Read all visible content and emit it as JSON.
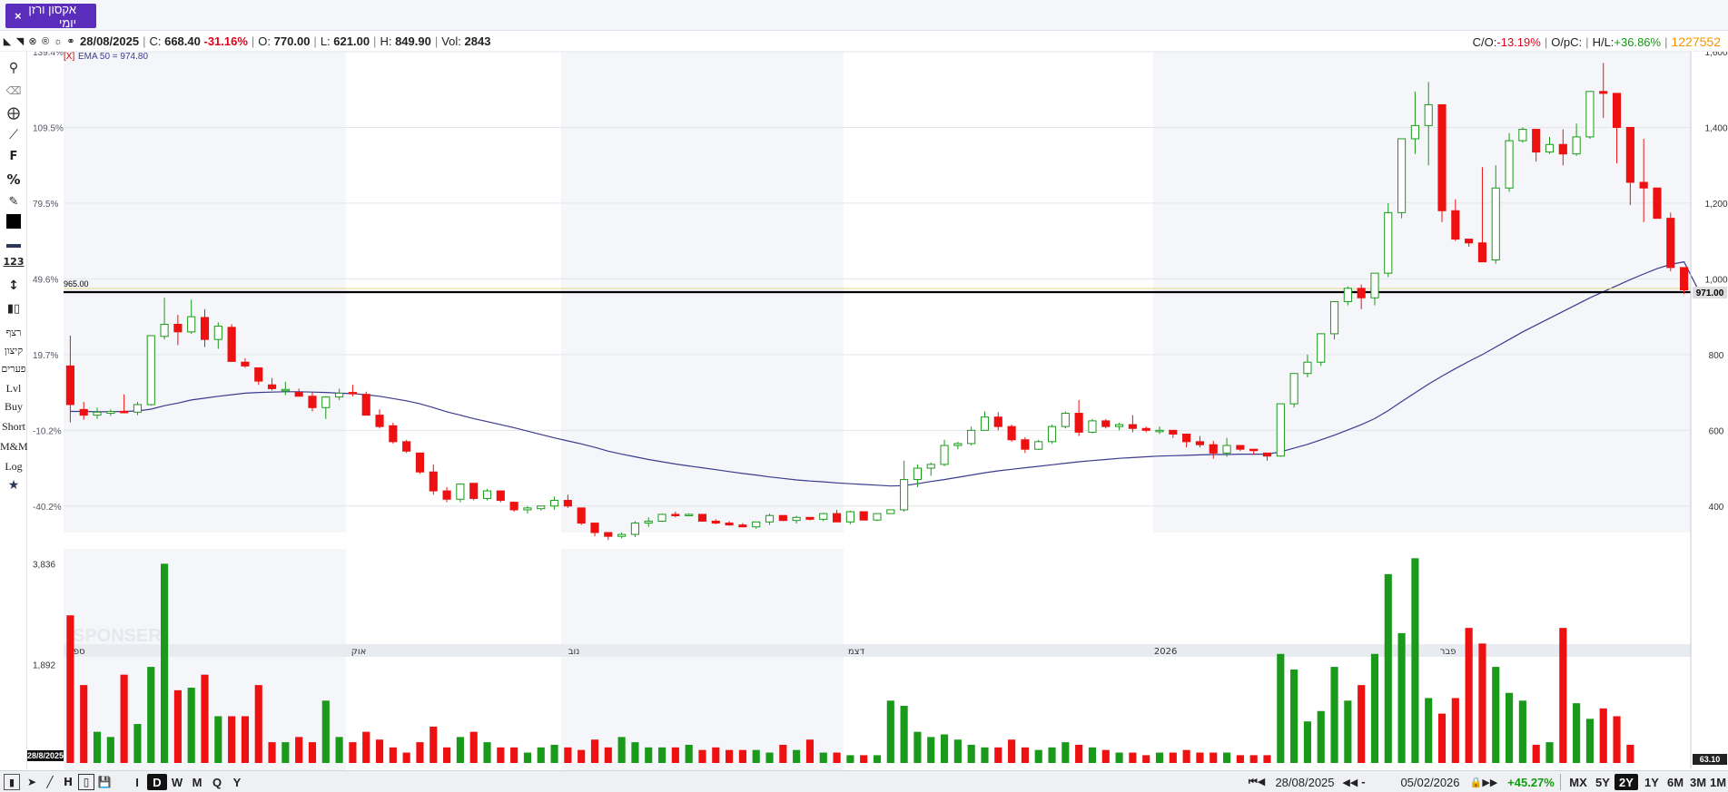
{
  "tab": {
    "label": "אקסון ורזן יומי",
    "close": "×"
  },
  "info": {
    "date": "28/08/2025",
    "c_label": "C:",
    "close": "668.40",
    "change": "-31.16%",
    "o_label": "O:",
    "open": "770.00",
    "l_label": "L:",
    "low": "621.00",
    "h_label": "H:",
    "high": "849.90",
    "vol_label": "Vol:",
    "vol": "2843",
    "co_label": "C/O:",
    "co": "-13.19%",
    "opc_label": "O/pC:",
    "hl_label": "H/L:",
    "hl": "+36.86%",
    "counter": "1227552"
  },
  "ema_label": "[X]",
  "ema_text": "EMA 50 = 974.80",
  "line_label": "965.00",
  "price_badge": "971.00",
  "vol_badge": "63.10",
  "date_badge": "28/8/2025",
  "watermark": "SPONSER",
  "left_labels": [
    "רצף",
    "קיצון",
    "פערים",
    "Lvl",
    "Buy",
    "Short",
    "M&M",
    "Log"
  ],
  "left_icons": [
    "chart-type-icon",
    "trend-icon",
    "crosshair-icon",
    "line-icon",
    "f-icon",
    "percent-icon",
    "pencil-icon",
    "color-icon",
    "line-width-icon",
    "number-icon",
    "vertical-icon",
    "candle-icon"
  ],
  "bottom": {
    "periods": [
      "I",
      "D",
      "W",
      "M",
      "Q",
      "Y"
    ],
    "selected_period": "D",
    "start_date": "28/08/2025",
    "end_date": "05/02/2026",
    "change": "+45.27%",
    "ranges": [
      "MX",
      "5Y",
      "2Y",
      "1Y",
      "6M",
      "3M",
      "1M"
    ],
    "selected_range": "2Y"
  },
  "colors": {
    "up": "#1a9a1a",
    "down": "#ee1111",
    "ema": "#3b3b8f",
    "accent": "#5b2dbd"
  },
  "chart_data": {
    "type": "candlestick",
    "ylim": [
      330,
      1600
    ],
    "yticks": [
      400,
      600,
      800,
      1000,
      1200,
      1400,
      1600
    ],
    "ytick_labels": [
      "400",
      "600",
      "800",
      "1,000",
      "1,200",
      "1,400",
      "1,600"
    ],
    "pct_ticks": [
      139.4,
      109.5,
      79.5,
      49.6,
      19.7,
      -10.2,
      -40.2
    ],
    "pct_labels": [
      "139.4%",
      "109.5%",
      "79.5%",
      "49.6%",
      "19.7%",
      "-10.2%",
      "-40.2%"
    ],
    "months": [
      "ספט",
      "אוק",
      "נוב",
      "דצמ",
      "2026",
      "פבר"
    ],
    "month_index": [
      0,
      21,
      37,
      58,
      81,
      102
    ],
    "hline": 965,
    "ohlc": [
      [
        770,
        850,
        621,
        668
      ],
      [
        655,
        675,
        628,
        640
      ],
      [
        640,
        660,
        630,
        648
      ],
      [
        645,
        655,
        638,
        650
      ],
      [
        650,
        695,
        645,
        648
      ],
      [
        648,
        675,
        640,
        668
      ],
      [
        668,
        850,
        665,
        850
      ],
      [
        848,
        950,
        840,
        880
      ],
      [
        880,
        905,
        825,
        860
      ],
      [
        860,
        945,
        855,
        900
      ],
      [
        898,
        920,
        820,
        840
      ],
      [
        840,
        885,
        815,
        875
      ],
      [
        872,
        880,
        800,
        782
      ],
      [
        780,
        790,
        765,
        770
      ],
      [
        765,
        750,
        720,
        730
      ],
      [
        720,
        738,
        705,
        710
      ],
      [
        705,
        728,
        693,
        708
      ],
      [
        700,
        710,
        695,
        690
      ],
      [
        690,
        700,
        650,
        660
      ],
      [
        660,
        690,
        630,
        688
      ],
      [
        688,
        710,
        680,
        698
      ],
      [
        700,
        720,
        690,
        697
      ],
      [
        695,
        702,
        640,
        640
      ],
      [
        640,
        655,
        605,
        610
      ],
      [
        612,
        620,
        565,
        570
      ],
      [
        570,
        575,
        540,
        545
      ],
      [
        540,
        490,
        485,
        490
      ],
      [
        490,
        510,
        430,
        440
      ],
      [
        440,
        450,
        410,
        418
      ],
      [
        418,
        460,
        410,
        458
      ],
      [
        460,
        460,
        415,
        420
      ],
      [
        420,
        445,
        415,
        440
      ],
      [
        440,
        440,
        410,
        415
      ],
      [
        410,
        412,
        385,
        390
      ],
      [
        390,
        400,
        380,
        395
      ],
      [
        393,
        400,
        388,
        400
      ],
      [
        400,
        425,
        390,
        415
      ],
      [
        415,
        430,
        395,
        400
      ],
      [
        395,
        360,
        350,
        355
      ],
      [
        355,
        355,
        320,
        330
      ],
      [
        330,
        330,
        310,
        320
      ],
      [
        320,
        330,
        315,
        325
      ],
      [
        325,
        360,
        318,
        355
      ],
      [
        355,
        370,
        345,
        360
      ],
      [
        360,
        380,
        358,
        378
      ],
      [
        378,
        385,
        370,
        376
      ],
      [
        376,
        380,
        374,
        378
      ],
      [
        378,
        375,
        360,
        360
      ],
      [
        360,
        365,
        352,
        355
      ],
      [
        355,
        360,
        348,
        350
      ],
      [
        350,
        355,
        345,
        345
      ],
      [
        345,
        358,
        340,
        358
      ],
      [
        358,
        380,
        350,
        375
      ],
      [
        375,
        375,
        360,
        362
      ],
      [
        362,
        374,
        354,
        370
      ],
      [
        370,
        365,
        362,
        365
      ],
      [
        365,
        382,
        360,
        380
      ],
      [
        380,
        390,
        360,
        358
      ],
      [
        358,
        388,
        352,
        385
      ],
      [
        385,
        385,
        362,
        363
      ],
      [
        363,
        380,
        360,
        380
      ],
      [
        380,
        380,
        385,
        390
      ],
      [
        390,
        520,
        385,
        470
      ],
      [
        470,
        510,
        450,
        500
      ],
      [
        500,
        515,
        480,
        510
      ],
      [
        510,
        575,
        505,
        560
      ],
      [
        560,
        570,
        550,
        565
      ],
      [
        565,
        610,
        560,
        600
      ],
      [
        600,
        650,
        600,
        635
      ],
      [
        635,
        648,
        600,
        610
      ],
      [
        610,
        615,
        570,
        575
      ],
      [
        575,
        582,
        540,
        550
      ],
      [
        550,
        575,
        548,
        570
      ],
      [
        570,
        615,
        565,
        610
      ],
      [
        610,
        650,
        605,
        645
      ],
      [
        645,
        680,
        585,
        595
      ],
      [
        595,
        630,
        592,
        625
      ],
      [
        625,
        630,
        605,
        610
      ],
      [
        610,
        620,
        600,
        615
      ],
      [
        615,
        640,
        595,
        605
      ],
      [
        605,
        610,
        595,
        600
      ],
      [
        600,
        610,
        590,
        600
      ],
      [
        600,
        600,
        580,
        590
      ],
      [
        590,
        570,
        555,
        570
      ],
      [
        570,
        585,
        555,
        562
      ],
      [
        562,
        572,
        525,
        540
      ],
      [
        540,
        580,
        530,
        560
      ],
      [
        560,
        558,
        545,
        550
      ],
      [
        550,
        545,
        535,
        548
      ],
      [
        540,
        520,
        520,
        532
      ],
      [
        532,
        660,
        530,
        670
      ],
      [
        670,
        740,
        660,
        750
      ],
      [
        750,
        800,
        740,
        780
      ],
      [
        780,
        850,
        770,
        855
      ],
      [
        855,
        920,
        840,
        940
      ],
      [
        940,
        980,
        930,
        975
      ],
      [
        975,
        985,
        920,
        950
      ],
      [
        950,
        1015,
        930,
        1015
      ],
      [
        1015,
        1200,
        1005,
        1175
      ],
      [
        1175,
        1300,
        1160,
        1370
      ],
      [
        1370,
        1495,
        1330,
        1405
      ],
      [
        1405,
        1520,
        1300,
        1460
      ],
      [
        1460,
        1410,
        1150,
        1180
      ],
      [
        1180,
        1210,
        1100,
        1105
      ],
      [
        1105,
        1100,
        1085,
        1095
      ],
      [
        1095,
        1295,
        1050,
        1045
      ],
      [
        1050,
        1300,
        1040,
        1240
      ],
      [
        1240,
        1385,
        1230,
        1365
      ],
      [
        1365,
        1400,
        1360,
        1395
      ],
      [
        1395,
        1380,
        1310,
        1335
      ],
      [
        1335,
        1375,
        1330,
        1355
      ],
      [
        1355,
        1395,
        1300,
        1330
      ],
      [
        1330,
        1410,
        1325,
        1375
      ],
      [
        1375,
        1490,
        1370,
        1495
      ],
      [
        1495,
        1570,
        1425,
        1490
      ],
      [
        1490,
        1460,
        1305,
        1400
      ],
      [
        1400,
        1330,
        1195,
        1255
      ],
      [
        1255,
        1370,
        1150,
        1240
      ],
      [
        1240,
        1230,
        1165,
        1160
      ],
      [
        1160,
        1175,
        1020,
        1030
      ],
      [
        1030,
        990,
        960,
        971
      ]
    ],
    "volume_ylim": [
      0,
      4000
    ],
    "volume_ticks": [
      "1,892",
      "3,836"
    ],
    "volume": [
      2843,
      1500,
      600,
      500,
      1700,
      750,
      1850,
      3836,
      1400,
      1450,
      1700,
      900,
      900,
      900,
      1500,
      400,
      400,
      500,
      400,
      1200,
      500,
      400,
      600,
      450,
      300,
      200,
      400,
      700,
      300,
      500,
      600,
      400,
      300,
      300,
      200,
      300,
      350,
      300,
      250,
      450,
      300,
      500,
      400,
      300,
      300,
      300,
      350,
      250,
      300,
      250,
      250,
      250,
      200,
      350,
      250,
      450,
      200,
      200,
      150,
      150,
      150,
      1200,
      1100,
      600,
      500,
      550,
      450,
      350,
      300,
      300,
      450,
      300,
      250,
      300,
      400,
      350,
      300,
      250,
      200,
      200,
      150,
      200,
      200,
      250,
      200,
      200,
      200,
      150,
      150,
      150,
      2100,
      1800,
      800,
      1000,
      1850,
      1200,
      1500,
      2100,
      3636,
      2500,
      3942,
      1250,
      950,
      1250,
      2600,
      2300,
      1850,
      1350,
      1200,
      350,
      400,
      2600,
      1150,
      850,
      1050,
      900,
      350
    ],
    "ema": [
      650,
      650,
      649,
      649,
      650,
      651,
      656,
      665,
      672,
      680,
      685,
      690,
      694,
      698,
      700,
      701,
      702,
      702,
      701,
      700,
      698,
      697,
      694,
      690,
      684,
      678,
      670,
      660,
      649,
      640,
      631,
      623,
      615,
      607,
      598,
      589,
      580,
      572,
      564,
      555,
      545,
      537,
      530,
      523,
      517,
      511,
      506,
      501,
      496,
      491,
      486,
      482,
      477,
      473,
      469,
      466,
      464,
      461,
      459,
      457,
      455,
      453,
      454,
      459,
      465,
      470,
      476,
      482,
      488,
      493,
      497,
      501,
      505,
      509,
      513,
      517,
      520,
      523,
      526,
      528,
      530,
      532,
      533,
      534,
      535,
      536,
      536,
      537,
      537,
      537,
      543,
      553,
      563,
      575,
      587,
      601,
      615,
      631,
      652,
      676,
      699,
      722,
      743,
      763,
      782,
      800,
      820,
      840,
      860,
      878,
      896,
      914,
      932,
      950,
      966,
      982,
      998,
      1013,
      1027,
      1038,
      1045,
      975
    ]
  }
}
